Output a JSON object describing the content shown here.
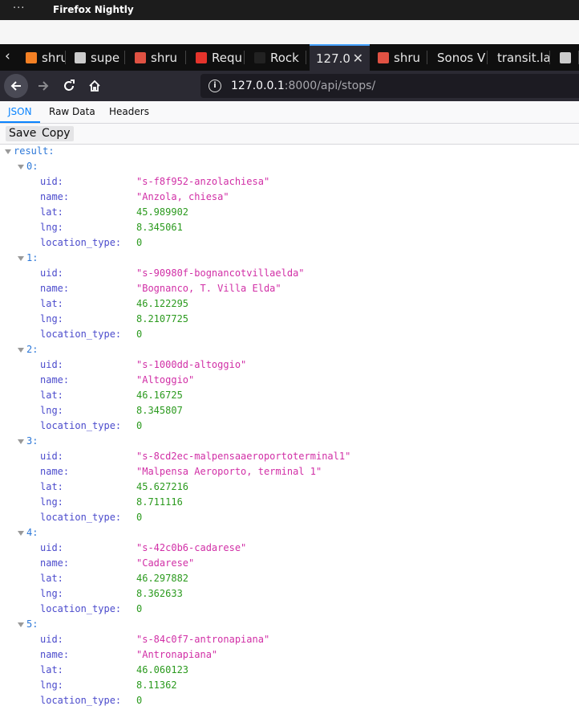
{
  "os": {
    "title": "Firefox Nightly",
    "menu_glyph": "···"
  },
  "tabs": [
    {
      "label": "shru",
      "icon": "stackoverflow-icon",
      "color": "#f48024"
    },
    {
      "label": "supe",
      "icon": "document-icon",
      "color": "#cccccc"
    },
    {
      "label": "shru",
      "icon": "gear-icon",
      "color": "#e05243"
    },
    {
      "label": "Requ",
      "icon": "rocket-icon",
      "color": "#e5342c"
    },
    {
      "label": "Rock",
      "icon": "moon-icon",
      "color": "#222222"
    },
    {
      "label": "127.0",
      "icon": "",
      "color": "#45a1ff",
      "active": true
    },
    {
      "label": "shru",
      "icon": "gear-icon",
      "color": "#e05243"
    },
    {
      "label": "Sonos V",
      "icon": "",
      "color": "#cccccc"
    },
    {
      "label": "transit.la",
      "icon": "",
      "color": "#cccccc"
    },
    {
      "label": "",
      "icon": "document-icon",
      "color": "#cccccc"
    }
  ],
  "nav": {
    "url_host": "127.0.0.1",
    "url_rest": ":8000/api/stops/"
  },
  "viewer": {
    "tabs": [
      "JSON",
      "Raw Data",
      "Headers"
    ],
    "buttons": [
      "Save",
      "Copy"
    ]
  },
  "tree": {
    "root_key": "result:",
    "field_keys": [
      "uid:",
      "name:",
      "lat:",
      "lng:",
      "location_type:"
    ],
    "items": [
      {
        "index": "0:",
        "uid": "\"s-f8f952-anzolachiesa\"",
        "name": "\"Anzola, chiesa\"",
        "lat": "45.989902",
        "lng": "8.345061",
        "location_type": "0"
      },
      {
        "index": "1:",
        "uid": "\"s-90980f-bognancotvillaelda\"",
        "name": "\"Bognanco, T. Villa Elda\"",
        "lat": "46.122295",
        "lng": "8.2107725",
        "location_type": "0"
      },
      {
        "index": "2:",
        "uid": "\"s-1000dd-altoggio\"",
        "name": "\"Altoggio\"",
        "lat": "46.16725",
        "lng": "8.345807",
        "location_type": "0"
      },
      {
        "index": "3:",
        "uid": "\"s-8cd2ec-malpensaaeroportoterminal1\"",
        "name": "\"Malpensa Aeroporto, terminal 1\"",
        "lat": "45.627216",
        "lng": "8.711116",
        "location_type": "0"
      },
      {
        "index": "4:",
        "uid": "\"s-42c0b6-cadarese\"",
        "name": "\"Cadarese\"",
        "lat": "46.297882",
        "lng": "8.362633",
        "location_type": "0"
      },
      {
        "index": "5:",
        "uid": "\"s-84c0f7-antronapiana\"",
        "name": "\"Antronapiana\"",
        "lat": "46.060123",
        "lng": "8.11362",
        "location_type": "0"
      }
    ]
  }
}
